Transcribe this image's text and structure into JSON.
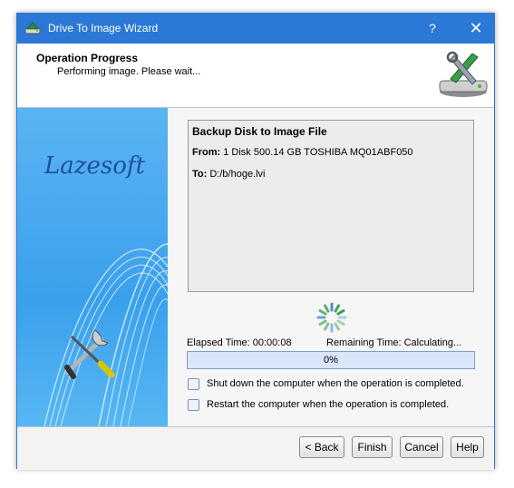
{
  "window": {
    "title": "Drive To Image Wizard",
    "help_glyph": "?",
    "close_glyph": "✕"
  },
  "header": {
    "title": "Operation Progress",
    "subtitle": "Performing image. Please wait..."
  },
  "sidebar": {
    "brand": "Lazesoft"
  },
  "info": {
    "heading": "Backup Disk to Image File",
    "from_label": "From:",
    "from_value": "1 Disk 500.14 GB TOSHIBA MQ01ABF050",
    "to_label": "To:",
    "to_value": "D:/b/hoge.lvi"
  },
  "status": {
    "elapsed_label": "Elapsed Time:",
    "elapsed_value": "00:00:08",
    "remaining_label": "Remaining Time:",
    "remaining_value": "Calculating..."
  },
  "progress": {
    "percent_text": "0%",
    "value": 0
  },
  "options": {
    "shutdown_label": "Shut down the computer when the operation is completed.",
    "restart_label": "Restart the computer when the operation is completed."
  },
  "buttons": {
    "back": "< Back",
    "finish": "Finish",
    "cancel": "Cancel",
    "help": "Help"
  },
  "colors": {
    "titlebar": "#2b78d6",
    "progress_fill": "#3b84e0",
    "spinner": "#2f9a47"
  },
  "icons": {
    "app": "drive-wizard-icon",
    "header": "disk-tools-icon",
    "spinner": "busy-spinner-icon"
  }
}
